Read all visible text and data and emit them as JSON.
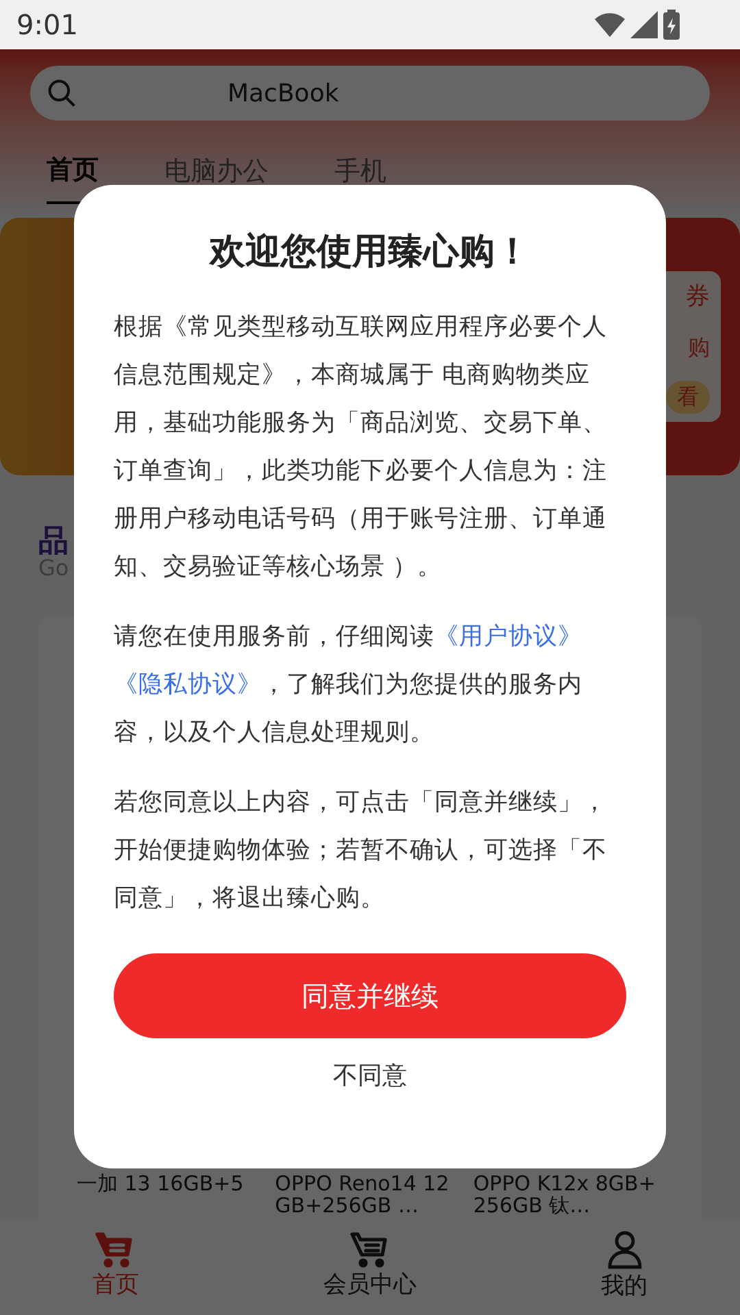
{
  "status_bar": {
    "time": "9:01"
  },
  "search": {
    "value": "MacBook"
  },
  "tabs": [
    {
      "label": "首页",
      "selected": true
    },
    {
      "label": "电脑办公",
      "selected": false
    },
    {
      "label": "手机",
      "selected": false
    }
  ],
  "banner": {
    "fragments": [
      "券",
      "购",
      "看"
    ]
  },
  "section": {
    "title": "品",
    "subtitle": "Go"
  },
  "products": [
    {
      "name": "一加 13 16GB+5"
    },
    {
      "name": "OPPO Reno14 12GB+256GB …"
    },
    {
      "name": "OPPO K12x 8GB+256GB 钛…"
    }
  ],
  "bottom_nav": [
    {
      "label": "首页",
      "selected": true
    },
    {
      "label": "会员中心",
      "selected": false
    },
    {
      "label": "我的",
      "selected": false
    }
  ],
  "dialog": {
    "title": "欢迎您使用臻心购！",
    "paragraph_1": "根据《常见类型移动互联网应用程序必要个人信息范围规定》，本商城属于 电商购物类应用，基础功能服务为「商品浏览、交易下单、订单查询」，此类功能下必要个人信息为：注册用户移动电话号码（用于账号注册、订单通知、交易验证等核心场景 ）。",
    "paragraph_2": {
      "before": "请您在使用服务前，仔细阅读",
      "links": [
        "《用户协议》",
        "《隐私协议》"
      ],
      "after": "，了解我们为您提供的服务内容，以及个人信息处理规则。"
    },
    "paragraph_3": "若您同意以上内容，可点击「同意并继续」，开始便捷购物体验；若暂不确认，可选择「不同意」，将退出臻心购。",
    "agree_button": "同意并继续",
    "decline_button": "不同意"
  }
}
